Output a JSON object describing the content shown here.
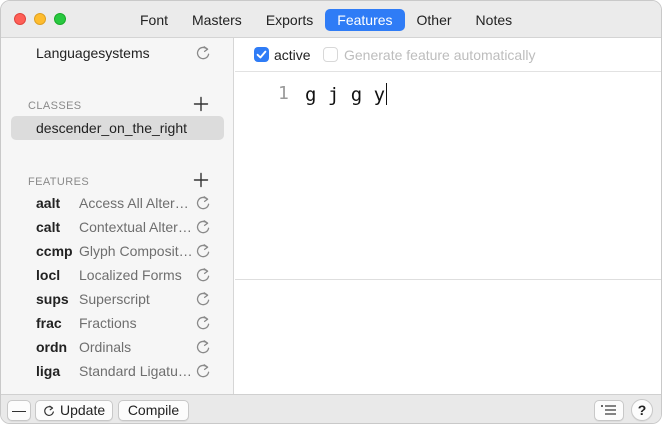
{
  "toolbar": {
    "tabs": [
      {
        "label": "Font"
      },
      {
        "label": "Masters"
      },
      {
        "label": "Exports"
      },
      {
        "label": "Features",
        "active": true
      },
      {
        "label": "Other"
      },
      {
        "label": "Notes"
      }
    ]
  },
  "sidebar": {
    "languagesystems_label": "Languagesystems",
    "classes_title": "CLASSES",
    "classes": [
      {
        "name": "descender_on_the_right",
        "selected": true
      }
    ],
    "features_title": "FEATURES",
    "features": [
      {
        "tag": "aalt",
        "name": "Access All Alternates"
      },
      {
        "tag": "calt",
        "name": "Contextual Alternates"
      },
      {
        "tag": "ccmp",
        "name": "Glyph Composition/Decomposition"
      },
      {
        "tag": "locl",
        "name": "Localized Forms"
      },
      {
        "tag": "sups",
        "name": "Superscript"
      },
      {
        "tag": "frac",
        "name": "Fractions"
      },
      {
        "tag": "ordn",
        "name": "Ordinals"
      },
      {
        "tag": "liga",
        "name": "Standard Ligatures"
      }
    ]
  },
  "editor": {
    "active_label": "active",
    "active_checked": true,
    "generate_label": "Generate feature automatically",
    "generate_checked": false,
    "line_number": "1",
    "code": "g j g y"
  },
  "bottom": {
    "minus_label": "—",
    "update_label": "Update",
    "compile_label": "Compile",
    "help_label": "?"
  },
  "colors": {
    "accent": "#2f7cf6",
    "close": "#fe5f57",
    "minimize": "#febc2e",
    "zoom": "#28c840"
  }
}
